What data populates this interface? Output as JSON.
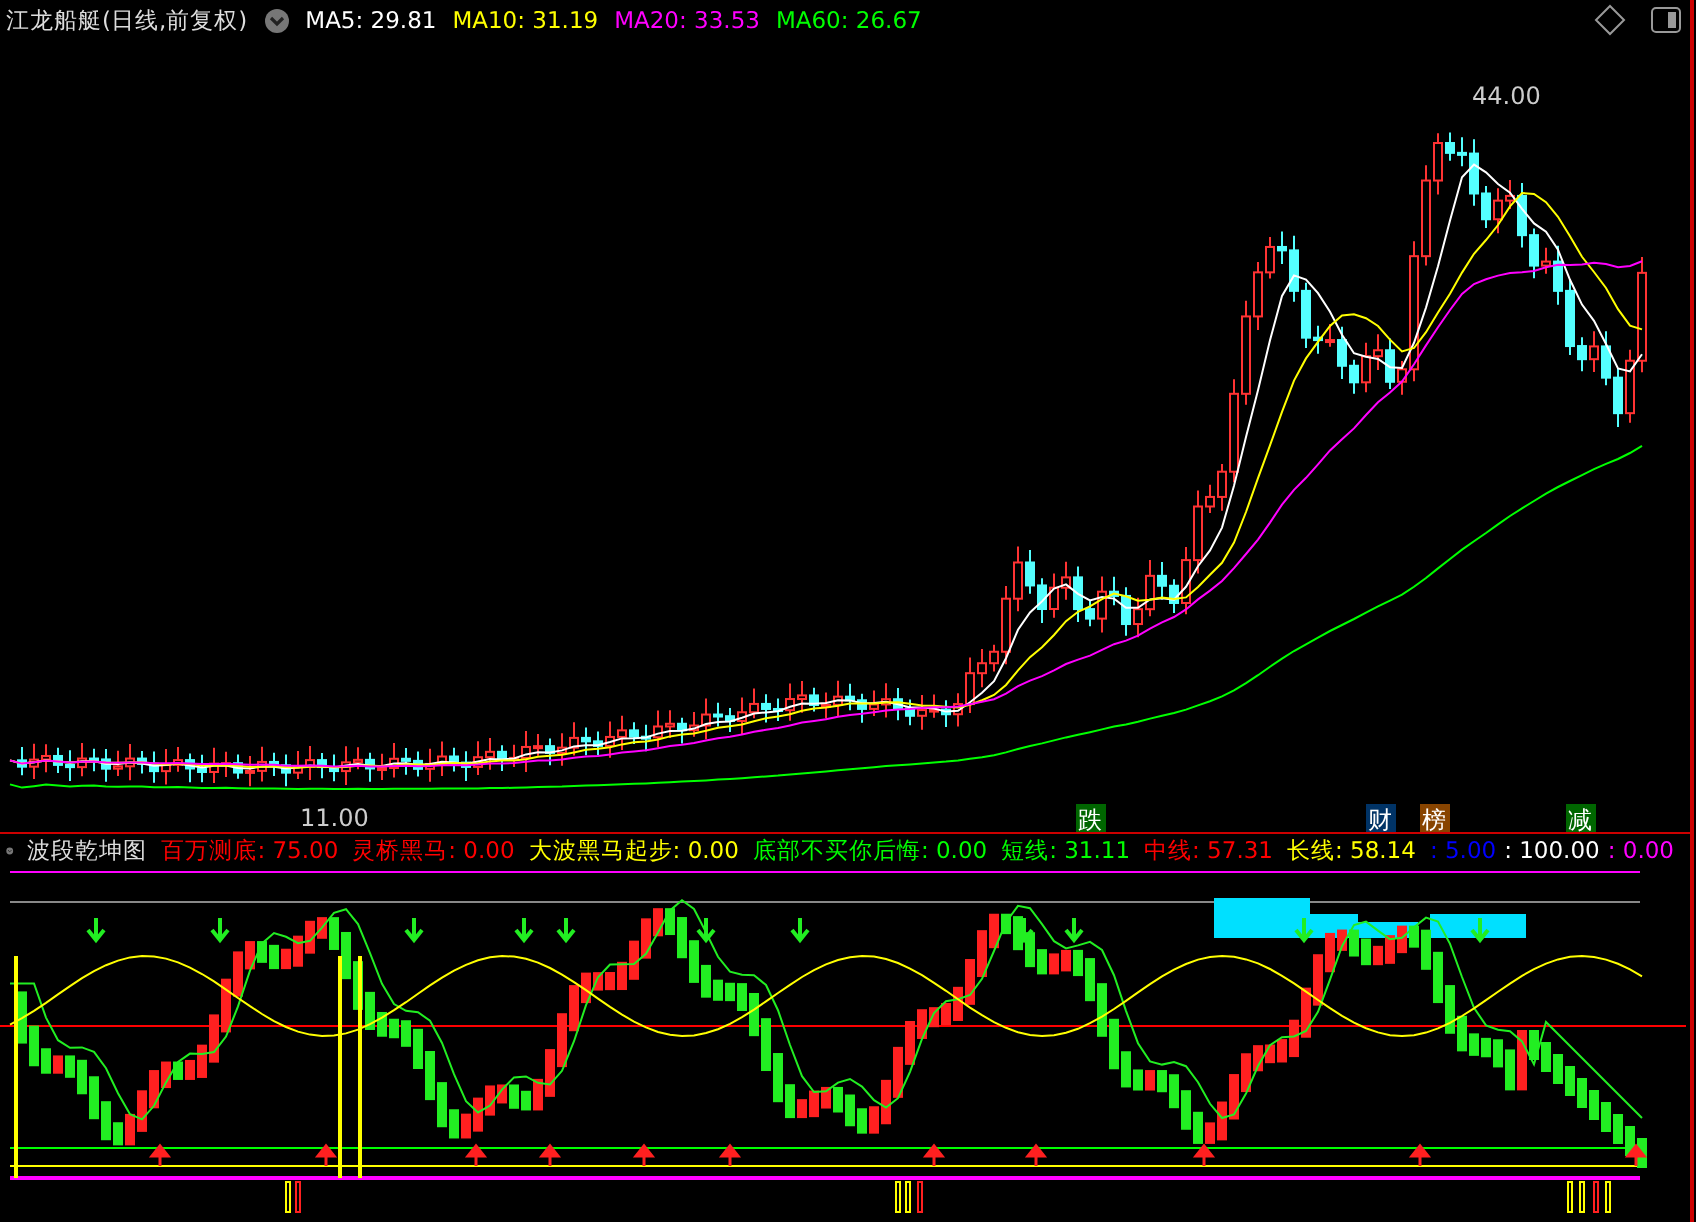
{
  "header": {
    "title": "江龙船艇(日线,前复权)",
    "ma": [
      {
        "label": "MA5:",
        "value": "29.81",
        "color": "#ffffff"
      },
      {
        "label": "MA10:",
        "value": "31.19",
        "color": "#ffff00"
      },
      {
        "label": "MA20:",
        "value": "33.53",
        "color": "#ff00ff"
      },
      {
        "label": "MA60:",
        "value": "26.67",
        "color": "#00ff00"
      }
    ]
  },
  "main_chart": {
    "high_label": "44.00",
    "low_label": "11.00"
  },
  "event_markers": [
    {
      "text": "跌",
      "color": "#006600"
    },
    {
      "text": "财",
      "color": "#003366"
    },
    {
      "text": "榜",
      "color": "#884400"
    },
    {
      "text": "减",
      "color": "#006600"
    }
  ],
  "indicator": {
    "title": "波段乾坤图",
    "values": [
      {
        "label": "百万测底:",
        "value": "75.00",
        "color": "#ff0000"
      },
      {
        "label": "灵桥黑马:",
        "value": "0.00",
        "color": "#ff0000"
      },
      {
        "label": "大波黑马起步:",
        "value": "0.00",
        "color": "#ffff00"
      },
      {
        "label": "底部不买你后悔:",
        "value": "0.00",
        "color": "#00ff00"
      },
      {
        "label": "短线:",
        "value": "31.11",
        "color": "#00ff00"
      },
      {
        "label": "中线:",
        "value": "57.31",
        "color": "#ff0000"
      },
      {
        "label": "长线:",
        "value": "58.14",
        "color": "#ffff00"
      }
    ],
    "extra_values": [
      {
        "label": ":",
        "value": "5.00",
        "color": "#0000ff"
      },
      {
        "label": ":",
        "value": "100.00",
        "color": "#ffffff"
      },
      {
        "label": ":",
        "value": "0.00",
        "color": "#ff00ff"
      }
    ]
  }
}
